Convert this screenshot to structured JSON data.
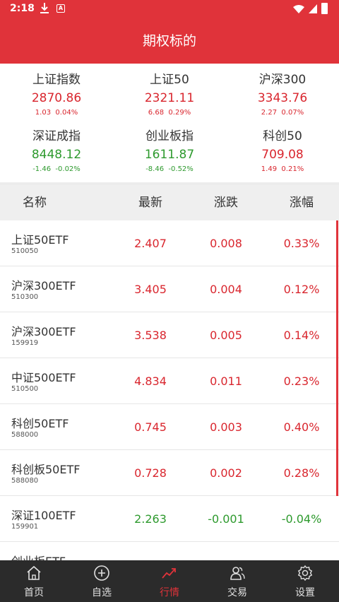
{
  "status_bar": {
    "time": "2:18"
  },
  "header": {
    "title": "期权标的"
  },
  "indices": [
    {
      "name": "上证指数",
      "value": "2870.86",
      "change": "1.03",
      "pct": "0.04%",
      "trend": "up"
    },
    {
      "name": "上证50",
      "value": "2321.11",
      "change": "6.68",
      "pct": "0.29%",
      "trend": "up"
    },
    {
      "name": "沪深300",
      "value": "3343.76",
      "change": "2.27",
      "pct": "0.07%",
      "trend": "up"
    },
    {
      "name": "深证成指",
      "value": "8448.12",
      "change": "-1.46",
      "pct": "-0.02%",
      "trend": "down"
    },
    {
      "name": "创业板指",
      "value": "1611.87",
      "change": "-8.46",
      "pct": "-0.52%",
      "trend": "down"
    },
    {
      "name": "科创50",
      "value": "709.08",
      "change": "1.49",
      "pct": "0.21%",
      "trend": "up"
    }
  ],
  "table": {
    "headers": {
      "name": "名称",
      "latest": "最新",
      "change": "涨跌",
      "pct": "涨幅"
    },
    "rows": [
      {
        "name": "上证50ETF",
        "code": "510050",
        "latest": "2.407",
        "change": "0.008",
        "pct": "0.33%",
        "trend": "up"
      },
      {
        "name": "沪深300ETF",
        "code": "510300",
        "latest": "3.405",
        "change": "0.004",
        "pct": "0.12%",
        "trend": "up"
      },
      {
        "name": "沪深300ETF",
        "code": "159919",
        "latest": "3.538",
        "change": "0.005",
        "pct": "0.14%",
        "trend": "up"
      },
      {
        "name": "中证500ETF",
        "code": "510500",
        "latest": "4.834",
        "change": "0.011",
        "pct": "0.23%",
        "trend": "up"
      },
      {
        "name": "科创50ETF",
        "code": "588000",
        "latest": "0.745",
        "change": "0.003",
        "pct": "0.40%",
        "trend": "up"
      },
      {
        "name": "科创板50ETF",
        "code": "588080",
        "latest": "0.728",
        "change": "0.002",
        "pct": "0.28%",
        "trend": "up"
      },
      {
        "name": "深证100ETF",
        "code": "159901",
        "latest": "2.263",
        "change": "-0.001",
        "pct": "-0.04%",
        "trend": "down"
      },
      {
        "name": "创业板ETF",
        "code": "",
        "latest": "",
        "change": "",
        "pct": "",
        "trend": "up"
      }
    ]
  },
  "tabs": [
    {
      "label": "首页",
      "icon": "home-icon",
      "active": false
    },
    {
      "label": "自选",
      "icon": "add-circle-icon",
      "active": false
    },
    {
      "label": "行情",
      "icon": "trend-icon",
      "active": true
    },
    {
      "label": "交易",
      "icon": "users-icon",
      "active": false
    },
    {
      "label": "设置",
      "icon": "gear-icon",
      "active": false
    }
  ],
  "colors": {
    "brand": "#e0333a",
    "up": "#d9262e",
    "down": "#2e9a2e",
    "tabbar": "#2b2b2b"
  }
}
